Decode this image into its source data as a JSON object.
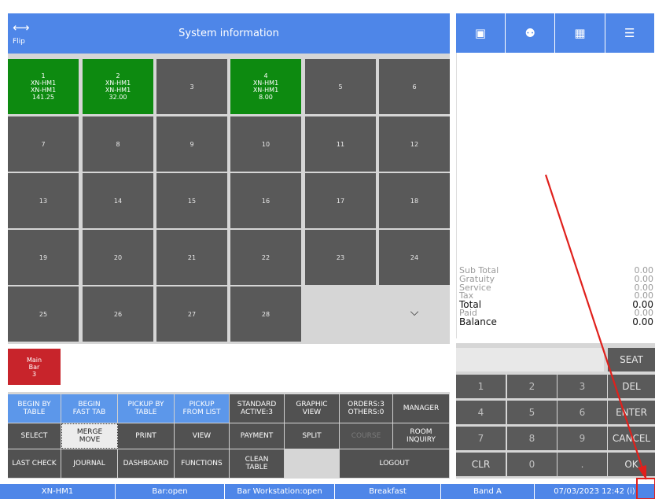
{
  "header": {
    "flip_label": "Flip",
    "flip_icon": "left-right-arrow-icon",
    "title": "System information",
    "color": "#4e86e8"
  },
  "tables": [
    {
      "label": "1\nXN-HM1\nXN-HM1\n141.25",
      "occupied": true
    },
    {
      "label": "2\nXN-HM1\nXN-HM1\n32.00",
      "occupied": true
    },
    {
      "label": "3",
      "occupied": false
    },
    {
      "label": "4\nXN-HM1\nXN-HM1\n8.00",
      "occupied": true
    },
    {
      "label": "5",
      "occupied": false
    },
    {
      "label": "6",
      "occupied": false
    },
    {
      "label": "7",
      "occupied": false
    },
    {
      "label": "8",
      "occupied": false
    },
    {
      "label": "9",
      "occupied": false
    },
    {
      "label": "10",
      "occupied": false
    },
    {
      "label": "11",
      "occupied": false
    },
    {
      "label": "12",
      "occupied": false
    },
    {
      "label": "13",
      "occupied": false
    },
    {
      "label": "14",
      "occupied": false
    },
    {
      "label": "15",
      "occupied": false
    },
    {
      "label": "16",
      "occupied": false
    },
    {
      "label": "17",
      "occupied": false
    },
    {
      "label": "18",
      "occupied": false
    },
    {
      "label": "19",
      "occupied": false
    },
    {
      "label": "20",
      "occupied": false
    },
    {
      "label": "21",
      "occupied": false
    },
    {
      "label": "22",
      "occupied": false
    },
    {
      "label": "23",
      "occupied": false
    },
    {
      "label": "24",
      "occupied": false
    },
    {
      "label": "25",
      "occupied": false
    },
    {
      "label": "26",
      "occupied": false
    },
    {
      "label": "27",
      "occupied": false
    },
    {
      "label": "28",
      "occupied": false
    }
  ],
  "area_button": {
    "label": "Main\nBar\n3",
    "color": "#c8242b"
  },
  "functions": {
    "row1": [
      "BEGIN BY\nTABLE",
      "BEGIN\nFAST TAB",
      "PICKUP BY\nTABLE",
      "PICKUP\nFROM LIST",
      "STANDARD\nACTIVE:3",
      "GRAPHIC\nVIEW",
      "ORDERS:3\nOTHERS:0",
      "MANAGER"
    ],
    "row2": [
      "SELECT",
      "MERGE\nMOVE",
      "PRINT",
      "VIEW",
      "PAYMENT",
      "SPLIT",
      "COURSE",
      "ROOM\nINQUIRY"
    ],
    "row3": [
      "LAST CHECK",
      "JOURNAL",
      "DASHBOARD",
      "FUNCTIONS",
      "CLEAN\nTABLE",
      "",
      "LOGOUT"
    ]
  },
  "right_tabs": [
    "table-icon",
    "guests-icon",
    "grid-icon",
    "receipt-icon"
  ],
  "totals": [
    {
      "label": "Sub Total",
      "value": "0.00",
      "strong": false
    },
    {
      "label": "Gratuity",
      "value": "0.00",
      "strong": false
    },
    {
      "label": "Service",
      "value": "0.00",
      "strong": false
    },
    {
      "label": "Tax",
      "value": "0.00",
      "strong": false
    },
    {
      "label": "Total",
      "value": "0.00",
      "strong": true
    },
    {
      "label": "Paid",
      "value": "0.00",
      "strong": false
    },
    {
      "label": "Balance",
      "value": "0.00",
      "strong": true
    }
  ],
  "keypad": {
    "seat": "SEAT",
    "rows": [
      [
        "1",
        "2",
        "3",
        "DEL"
      ],
      [
        "4",
        "5",
        "6",
        "ENTER"
      ],
      [
        "7",
        "8",
        "9",
        "CANCEL"
      ],
      [
        "CLR",
        "0",
        ".",
        "OK"
      ]
    ]
  },
  "status": [
    "XN-HM1",
    "Bar:open",
    "Bar Workstation:open",
    "Breakfast",
    "Band A",
    "07/03/2023 12:42 (i)"
  ],
  "colors": {
    "occupied": "#0d8a10",
    "tile": "#595959",
    "accent": "#4e86e8",
    "annotation": "#e0201c"
  }
}
